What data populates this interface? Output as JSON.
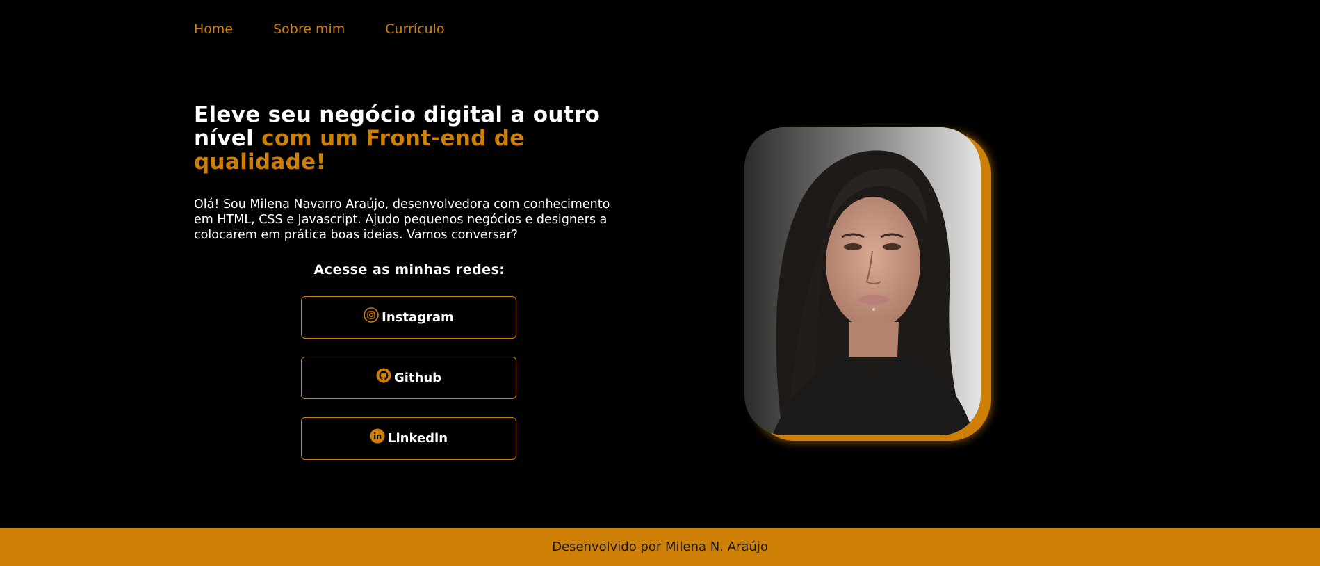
{
  "nav": {
    "items": [
      {
        "label": "Home"
      },
      {
        "label": "Sobre mim"
      },
      {
        "label": "Currículo"
      }
    ]
  },
  "hero": {
    "title_white": "Eleve seu negócio digital a outro nível ",
    "title_accent": "com um Front-end de qualidade!",
    "intro": "Olá! Sou Milena Navarro Araújo, desenvolvedora com conhecimento em HTML, CSS e Javascript. Ajudo pequenos negócios e designers a colocarem em prática boas ideias. Vamos conversar?"
  },
  "socials": {
    "heading": "Acesse as minhas redes:",
    "buttons": [
      {
        "label": "Instagram",
        "icon": "instagram-icon"
      },
      {
        "label": "Github",
        "icon": "github-icon"
      },
      {
        "label": "Linkedin",
        "icon": "linkedin-icon"
      }
    ]
  },
  "footer": {
    "text": "Desenvolvido por Milena N. Araújo"
  },
  "colors": {
    "accent": "#CD7F06",
    "background": "#000000",
    "text": "#FFFFFF"
  }
}
